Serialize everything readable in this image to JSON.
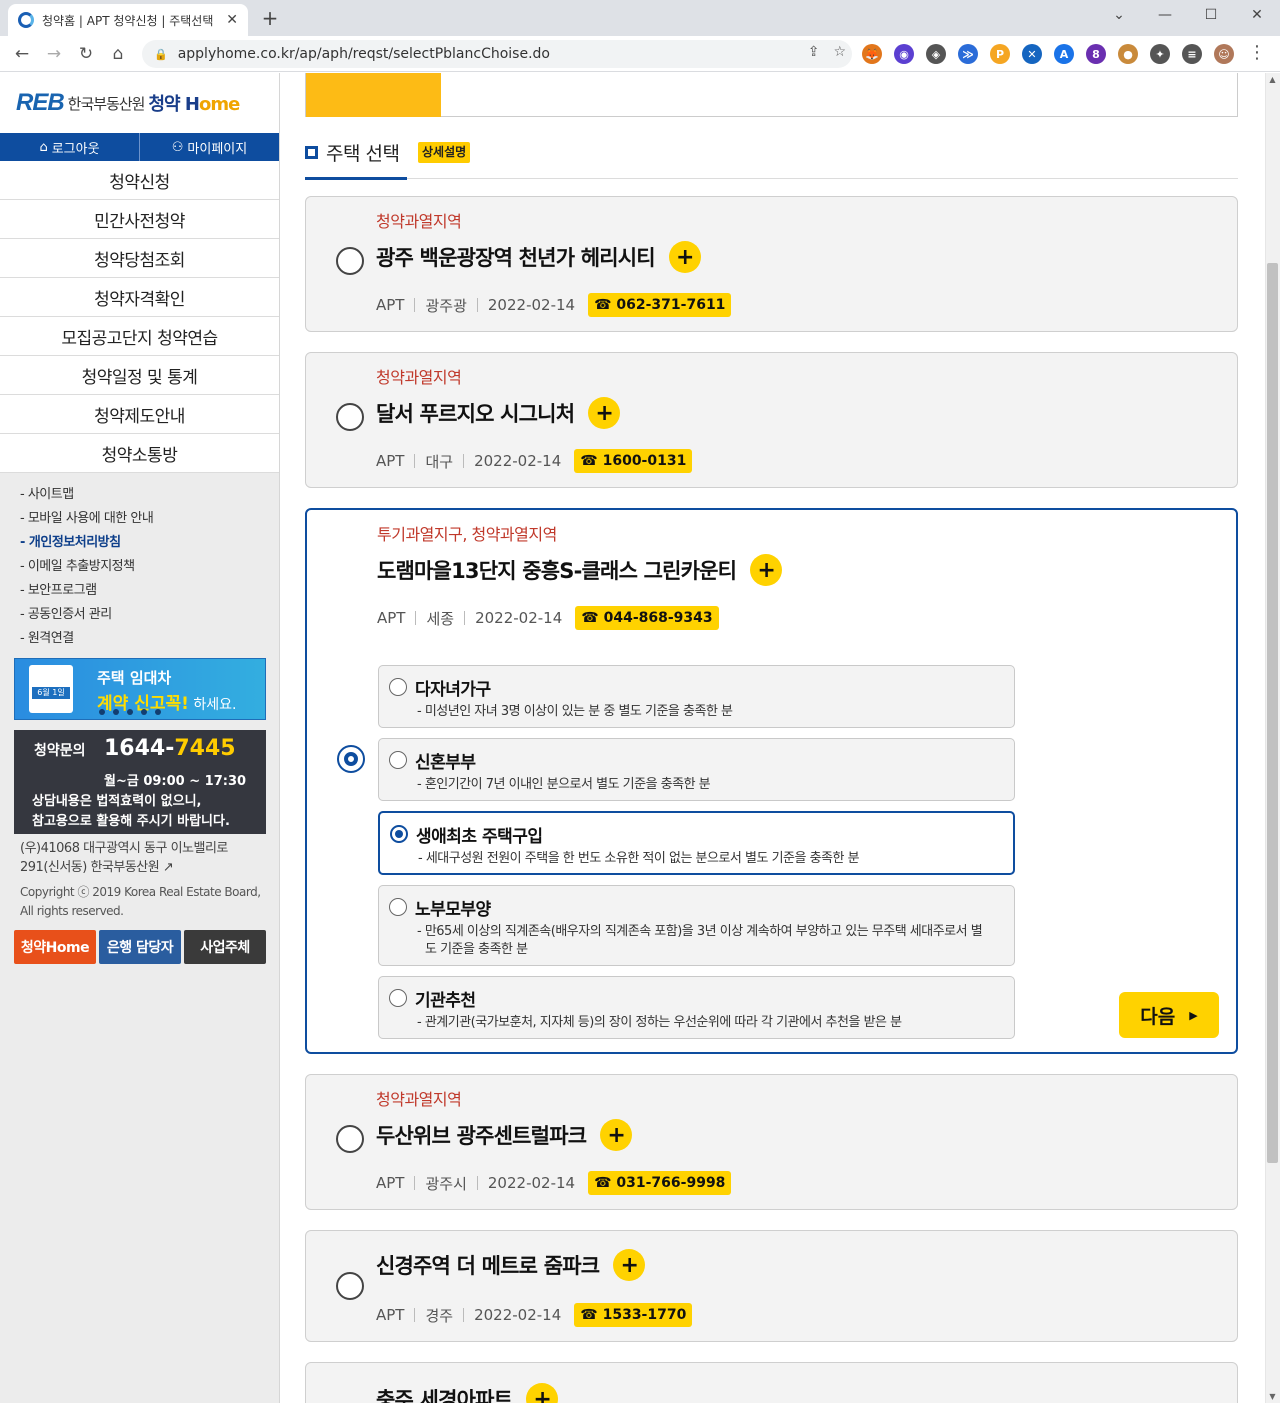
{
  "browser": {
    "tab_title": "청약홈 | APT 청약신청 | 주택선택",
    "tab_close": "✕",
    "new_tab": "+",
    "url": "applyhome.co.kr/ap/aph/reqst/selectPblancChoise.do",
    "window_controls": [
      "⌄",
      "—",
      "☐",
      "✕"
    ],
    "nav": {
      "back": "←",
      "forward": "→",
      "reload": "↻",
      "home": "⌂"
    },
    "omnibox_icons": {
      "share": "⇪",
      "star": "☆"
    },
    "extensions": [
      {
        "name": "fox-extension-icon",
        "color": "#e2761b",
        "glyph": "🦊"
      },
      {
        "name": "circle-extension-icon",
        "color": "#5b3fd1",
        "glyph": "◉"
      },
      {
        "name": "compass-extension-icon",
        "color": "#555555",
        "glyph": "◈"
      },
      {
        "name": "chevron-extension-icon",
        "color": "#2b6cd8",
        "glyph": "≫"
      },
      {
        "name": "p-extension-icon",
        "color": "#f5a623",
        "glyph": "P"
      },
      {
        "name": "x-extension-icon",
        "color": "#1565c0",
        "glyph": "✕"
      },
      {
        "name": "translate-extension-icon",
        "color": "#1a73e8",
        "glyph": "A"
      },
      {
        "name": "cube-extension-icon",
        "color": "#6a2fb0",
        "glyph": "8"
      },
      {
        "name": "cookie-extension-icon",
        "color": "#c98a3b",
        "glyph": "●"
      },
      {
        "name": "puzzle-icon",
        "color": "#555555",
        "glyph": "✦"
      },
      {
        "name": "reading-list-icon",
        "color": "#555555",
        "glyph": "≡"
      },
      {
        "name": "profile-avatar-icon",
        "color": "#b0785a",
        "glyph": "☺"
      }
    ],
    "menu": "⋮"
  },
  "sidebar": {
    "logo_reb": "REB",
    "logo_org": "한국부동산원",
    "logo_home": "청약",
    "logo_home_h": "H",
    "logo_home_ome": "ome",
    "logout": "로그아웃",
    "mypage": "마이페이지",
    "menu": [
      "청약신청",
      "민간사전청약",
      "청약당첨조회",
      "청약자격확인",
      "모집공고단지 청약연습",
      "청약일정 및 통계",
      "청약제도안내",
      "청약소통방"
    ],
    "links": [
      "- 사이트맵",
      "- 모바일 사용에 대한 안내",
      "- 개인정보처리방침",
      "- 이메일 추출방지정책",
      "- 보안프로그램",
      "- 공동인증서 관리",
      "- 원격연결"
    ],
    "banner": {
      "line1": "주택 임대차",
      "line2_bold": "계약 신고꼭!",
      "line2_rest": " 하세요.",
      "doc_label": "6월 1일"
    },
    "call": {
      "label": "청약문의",
      "num_a": "1644-",
      "num_b": "7445",
      "hours": "월~금 09:00 ~ 17:30",
      "note1": "상담내용은 법적효력이 없으니,",
      "note2": "참고용으로 활용해 주시기 바랍니다."
    },
    "address1": "(우)41068 대구광역시 동구 이노밸리로",
    "address2": "291(신서동) 한국부동산원 ↗",
    "copyright1": "Copyright ⓒ 2019 Korea Real Estate Board,",
    "copyright2": "All rights reserved.",
    "buttons": [
      {
        "label": "청약Home",
        "color": "#e8501a"
      },
      {
        "label": "은행 담당자",
        "color": "#2a5d9f"
      },
      {
        "label": "사업주체",
        "color": "#3a3a3a"
      }
    ]
  },
  "main": {
    "section_title": "주택 선택",
    "help_badge": "상세설명",
    "plus": "+",
    "listings": [
      {
        "region": "청약과열지역",
        "name": "광주 백운광장역 천년가 헤리시티",
        "type": "APT",
        "area": "광주광",
        "date": "2022-02-14",
        "tel": "☎ 062-371-7611",
        "selected": false
      },
      {
        "region": "청약과열지역",
        "name": "달서 푸르지오 시그니처",
        "type": "APT",
        "area": "대구",
        "date": "2022-02-14",
        "tel": "☎ 1600-0131",
        "selected": false
      },
      {
        "region": "투기과열지구, 청약과열지역",
        "name": "도램마을13단지 중흥S-클래스 그린카운티",
        "type": "APT",
        "area": "세종",
        "date": "2022-02-14",
        "tel": "☎ 044-868-9343",
        "selected": true
      },
      {
        "region": "청약과열지역",
        "name": "두산위브 광주센트럴파크",
        "type": "APT",
        "area": "광주시",
        "date": "2022-02-14",
        "tel": "☎ 031-766-9998",
        "selected": false
      },
      {
        "region": "",
        "name": "신경주역 더 메트로 줌파크",
        "type": "APT",
        "area": "경주",
        "date": "2022-02-14",
        "tel": "☎ 1533-1770",
        "selected": false
      },
      {
        "region": "",
        "name": "충주 세경아파트",
        "type": "",
        "area": "",
        "date": "",
        "tel": "",
        "selected": false
      }
    ],
    "options": [
      {
        "title": "다자녀가구",
        "desc": "- 미성년인 자녀 3명 이상이 있는 분 중 별도 기준을 충족한 분",
        "selected": false
      },
      {
        "title": "신혼부부",
        "desc": "- 혼인기간이 7년 이내인 분으로서 별도 기준을 충족한 분",
        "selected": false
      },
      {
        "title": "생애최초 주택구입",
        "desc": "- 세대구성원 전원이 주택을 한 번도 소유한 적이 없는 분으로서 별도 기준을 충족한 분",
        "selected": true
      },
      {
        "title": "노부모부양",
        "desc": "- 만65세 이상의 직계존속(배우자의 직계존속 포함)을 3년 이상 계속하여 부양하고 있는 무주택 세대주로서 별도 기준을 충족한 분",
        "selected": false
      },
      {
        "title": "기관추천",
        "desc": "- 관계기관(국가보훈처, 지자체 등)의 장이 정하는 우선순위에 따라 각 기관에서 추천을 받은 분",
        "selected": false
      }
    ],
    "next_label": "다음",
    "next_arrow": "▶"
  },
  "colors": {
    "brand_blue": "#0e4d9f",
    "yellow": "#ffd200",
    "region_red": "#c0392b"
  }
}
